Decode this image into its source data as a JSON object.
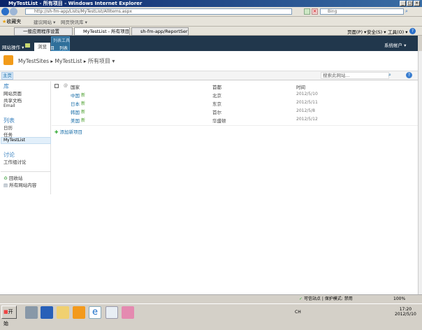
{
  "window": {
    "title": "MyTestList - 所有项目 - Windows Internet Explorer"
  },
  "address": {
    "url": "http://sh-fm-app/Lists/MyTestList/AllItems.aspx",
    "search_placeholder": "Bing"
  },
  "favorites": {
    "label": "收藏夹",
    "items": [
      "建议网站 ▾",
      "网页快讯库 ▾"
    ]
  },
  "tabs": [
    {
      "label": "一般应用程序设置"
    },
    {
      "label": "MyTestList - 所有项目"
    },
    {
      "label": "sh-fm-app/ReportServe..."
    }
  ],
  "commandbar": {
    "page": "页面(P) ▾",
    "safety": "安全(S) ▾",
    "tools": "工具(O) ▾"
  },
  "ribbon": {
    "site_actions": "网站操作 ▾",
    "browse": "浏览",
    "list_tools": "列表工具",
    "items": "项目",
    "list": "列表",
    "user": "系统帐户 ▾"
  },
  "breadcrumb": {
    "site": "MyTestSites",
    "list": "MyTestList",
    "view": "所有项目 ▾"
  },
  "topnav": {
    "home": "主页",
    "search_placeholder": "搜索此网站..."
  },
  "sidebar": {
    "libraries": {
      "heading": "库",
      "items": [
        "网站页面",
        "共享文档",
        "Email"
      ]
    },
    "lists": {
      "heading": "列表",
      "items": [
        "日历",
        "任务",
        "MyTestList"
      ]
    },
    "discussions": {
      "heading": "讨论",
      "items": [
        "工作组讨论"
      ]
    },
    "recycle": "回收站",
    "all_content": "所有网站内容"
  },
  "table": {
    "headers": [
      "国家",
      "首都",
      "时间"
    ],
    "new_badge": "新",
    "rows": [
      {
        "country": "中国",
        "capital": "北京",
        "date": "2012/5/10"
      },
      {
        "country": "日本",
        "capital": "东京",
        "date": "2012/5/11"
      },
      {
        "country": "韩国",
        "capital": "首尔",
        "date": "2012/5/8"
      },
      {
        "country": "美国",
        "capital": "华盛顿",
        "date": "2012/5/12"
      }
    ],
    "add_new": "添加新项目"
  },
  "statusbar": {
    "zone": "可信站点 | 保护模式: 禁用",
    "zoom": "100%"
  },
  "taskbar": {
    "start": "开始",
    "lang": "CH",
    "time": "17:20",
    "date": "2012/5/10"
  }
}
